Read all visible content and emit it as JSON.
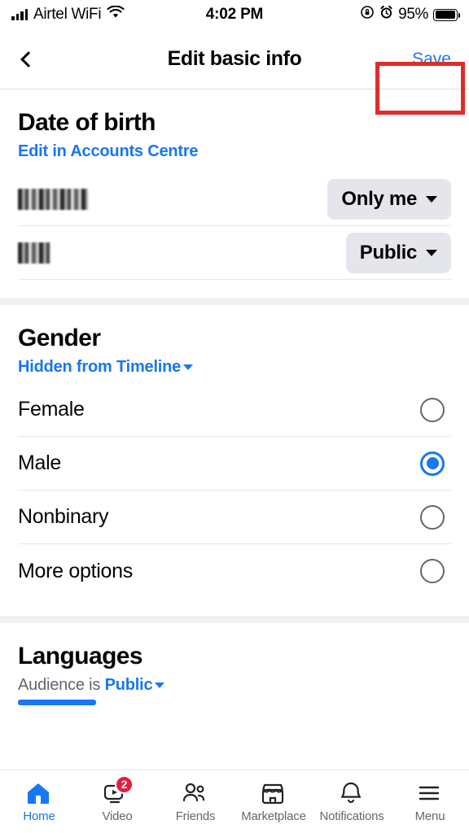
{
  "status_bar": {
    "carrier": "Airtel WiFi",
    "time": "4:02 PM",
    "battery_percent": "95%",
    "icons": [
      "signal-bars-icon",
      "wifi-icon",
      "rotation-lock-icon",
      "alarm-clock-icon",
      "battery-icon"
    ]
  },
  "header": {
    "back_label": "Back",
    "title": "Edit basic info",
    "save_label": "Save",
    "save_highlighted": true,
    "highlight_color": "#e02b2b"
  },
  "date_of_birth": {
    "title": "Date of birth",
    "edit_link": "Edit in Accounts Centre",
    "rows": [
      {
        "value": "",
        "redacted": true,
        "audience": "Only me"
      },
      {
        "value": "",
        "redacted": true,
        "audience": "Public"
      }
    ]
  },
  "gender": {
    "title": "Gender",
    "audience_link": "Hidden from Timeline",
    "options": [
      {
        "label": "Female",
        "selected": false
      },
      {
        "label": "Male",
        "selected": true
      },
      {
        "label": "Nonbinary",
        "selected": false
      },
      {
        "label": "More options",
        "selected": false
      }
    ]
  },
  "languages": {
    "title": "Languages",
    "audience_prefix": "Audience is ",
    "audience_value": "Public"
  },
  "bottom_nav": {
    "items": [
      {
        "label": "Home",
        "icon": "home-icon",
        "active": true,
        "badge": ""
      },
      {
        "label": "Video",
        "icon": "video-icon",
        "active": false,
        "badge": "2"
      },
      {
        "label": "Friends",
        "icon": "friends-icon",
        "active": false,
        "badge": ""
      },
      {
        "label": "Marketplace",
        "icon": "marketplace-icon",
        "active": false,
        "badge": ""
      },
      {
        "label": "Notifications",
        "icon": "notifications-bell-icon",
        "active": false,
        "badge": ""
      },
      {
        "label": "Menu",
        "icon": "hamburger-menu-icon",
        "active": false,
        "badge": ""
      }
    ]
  },
  "colors": {
    "accent_blue": "#1877f2",
    "pill_gray": "#e4e6eb",
    "badge_red": "#e41e3f",
    "highlight_red": "#e02b2b"
  }
}
